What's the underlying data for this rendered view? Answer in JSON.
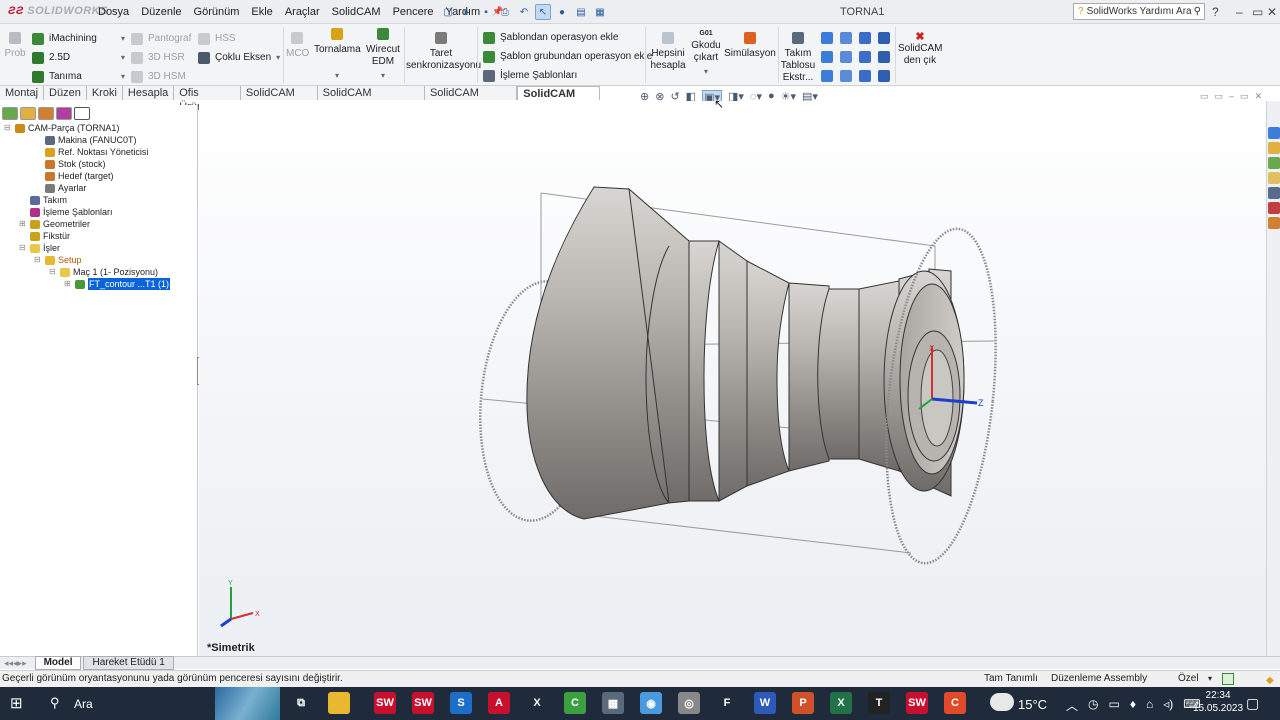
{
  "app": {
    "logo": "SOLIDWORKS",
    "window_title": "TORNA1"
  },
  "menu": [
    "Dosya",
    "Düzenle",
    "Görünüm",
    "Ekle",
    "Araçlar",
    "SolidCAM",
    "Pencere",
    "Yardım"
  ],
  "help_search": {
    "placeholder": "SolidWorks Yardımı Ara"
  },
  "ribbon": {
    "prob": "Prob",
    "col1": [
      {
        "label": "iMachining",
        "enabled": true
      },
      {
        "label": "2.5D",
        "enabled": true
      },
      {
        "label": "Tanıma",
        "enabled": true
      }
    ],
    "col2": [
      {
        "label": "Pantograf",
        "enabled": false
      },
      {
        "label": "3D HSR",
        "enabled": false
      },
      {
        "label": "3D HSM",
        "enabled": false
      }
    ],
    "col3": [
      {
        "label": "HSS",
        "enabled": false
      },
      {
        "label": "Çoklu Eksen",
        "enabled": true
      }
    ],
    "mco": "MCO",
    "tornalama": "Tornalama",
    "wirecut": [
      "Wirecut",
      "EDM"
    ],
    "taret": [
      "Taret",
      "senkronizasyonu"
    ],
    "templates": [
      "Şablondan operasyon ekle",
      "Şablon grubundan operasyon ekle",
      "İşleme Şablonları"
    ],
    "hepsini": [
      "Hepsini",
      "hesapla"
    ],
    "gkodu_icon": "G01",
    "gkodu": [
      "Gkodu",
      "çıkart"
    ],
    "simulasyon": "Simülasyon",
    "takim": [
      "Takım",
      "Tablosu",
      "Ekstr..."
    ],
    "solidcam_exit": [
      "SolidCAM",
      "den çık"
    ]
  },
  "tabs": [
    {
      "label": "Montaj",
      "active": false
    },
    {
      "label": "Düzen",
      "active": false
    },
    {
      "label": "Kroki",
      "active": false
    },
    {
      "label": "Hesapla",
      "active": false
    },
    {
      "label": "Ofis Ürünleri",
      "active": false
    },
    {
      "label": "SolidCAM Part",
      "active": false
    },
    {
      "label": "SolidCAM Operations",
      "active": false
    },
    {
      "label": "SolidCAM Parçası",
      "active": false
    },
    {
      "label": "SolidCAM İşler",
      "active": true
    }
  ],
  "tree": [
    {
      "label": "CAM-Parça (TORNA1)",
      "depth": 0,
      "icon": "#c98a1a",
      "exp": "-"
    },
    {
      "label": "Makina (FANUC0T)",
      "depth": 2,
      "icon": "#5a6a7a",
      "exp": ""
    },
    {
      "label": "Ref. Noktası Yöneticisi",
      "depth": 2,
      "icon": "#d9a21a",
      "exp": ""
    },
    {
      "label": "Stok (stock)",
      "depth": 2,
      "icon": "#c9772a",
      "exp": ""
    },
    {
      "label": "Hedef (target)",
      "depth": 2,
      "icon": "#c9772a",
      "exp": ""
    },
    {
      "label": "Ayarlar",
      "depth": 2,
      "icon": "#7a7a7a",
      "exp": ""
    },
    {
      "label": "Takım",
      "depth": 1,
      "icon": "#5a6a9a",
      "exp": ""
    },
    {
      "label": "İşleme Şablonları",
      "depth": 1,
      "icon": "#b0308a",
      "exp": ""
    },
    {
      "label": "Geometriler",
      "depth": 1,
      "icon": "#c9a21a",
      "exp": "+"
    },
    {
      "label": "Fikstür",
      "depth": 1,
      "icon": "#c9a21a",
      "exp": ""
    },
    {
      "label": "İşler",
      "depth": 1,
      "icon": "#e8c84a",
      "exp": "-"
    },
    {
      "label": "Setup",
      "depth": 2,
      "icon": "#e8b830",
      "exp": "-",
      "color": "#b05a00"
    },
    {
      "label": "Maç 1 (1- Pozisyonu)",
      "depth": 3,
      "icon": "#e8c84a",
      "exp": "-"
    },
    {
      "label": "FT_contour ...T1 (1)",
      "depth": 4,
      "icon": "#4a9a3a",
      "exp": "+",
      "selected": true
    }
  ],
  "viewport": {
    "view_label": "*Simetrik"
  },
  "bottom_tabs": [
    {
      "label": "Model",
      "active": true
    },
    {
      "label": "Hareket Etüdü 1",
      "active": false
    }
  ],
  "status": {
    "message": "Geçerli görünüm oryantasyonunu yada görünüm penceresi sayısını değiştirir.",
    "units": "Tam Tanımlı",
    "mode": "Düzenleme Assembly",
    "custom": "Özel"
  },
  "taskbar": {
    "search": "Ara",
    "weather": "15°C",
    "time": "22:34",
    "date": "15.05.2023"
  },
  "colors": {
    "accent": "#0a64d8",
    "solidworks_red": "#c8102e",
    "taskbar": "#1f2b3a"
  }
}
